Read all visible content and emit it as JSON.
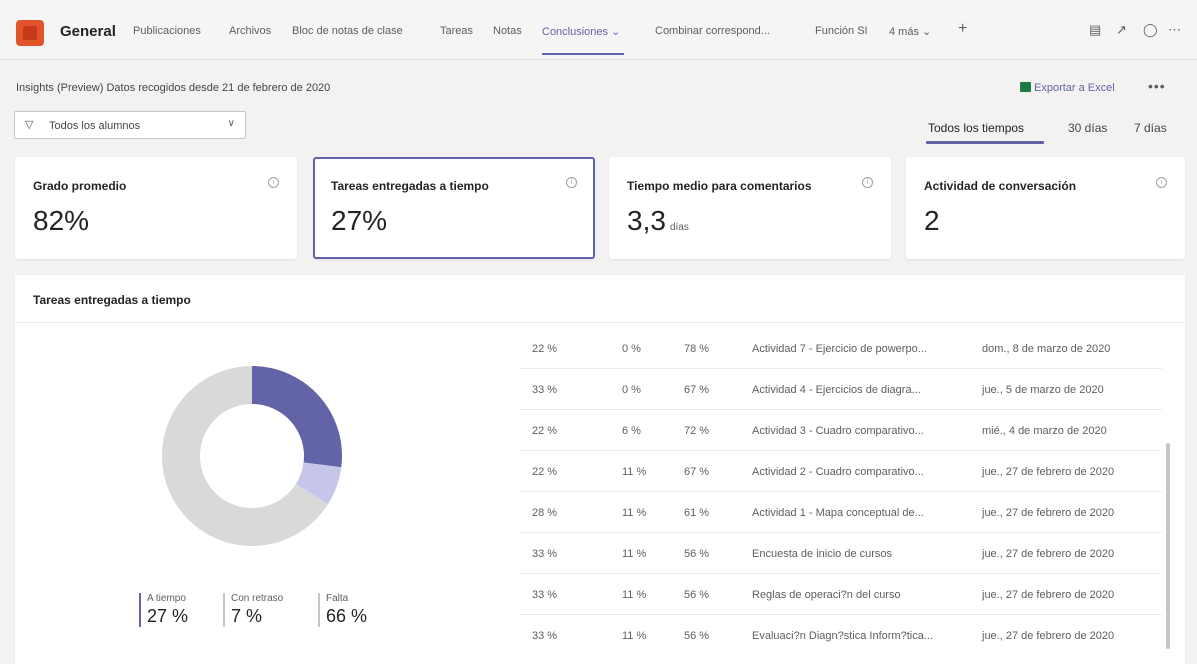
{
  "header": {
    "channel": "General",
    "tabs": [
      "Publicaciones",
      "Archivos",
      "Bloc de notas de clase",
      "Tareas",
      "Notas",
      "Conclusiones ⌄",
      "Combinar correspond...",
      "Función SI",
      "4 más ⌄"
    ],
    "active_tab_index": 5,
    "add_tab": "+"
  },
  "toolbar": {
    "insights_label": "Insights (Preview) Datos recogidos desde 21 de febrero de 2020",
    "export_label": "Exportar a Excel",
    "filter_label": "Todos los alumnos",
    "ranges": [
      "Todos los tiempos",
      "30 días",
      "7 días"
    ],
    "active_range_index": 0
  },
  "cards": [
    {
      "title": "Grado promedio",
      "value": "82%",
      "unit": ""
    },
    {
      "title": "Tareas entregadas a tiempo",
      "value": "27%",
      "unit": "",
      "selected": true
    },
    {
      "title": "Tiempo medio para comentarios",
      "value": "3,3",
      "unit": "días"
    },
    {
      "title": "Actividad de conversación",
      "value": "2",
      "unit": ""
    }
  ],
  "panel": {
    "title": "Tareas entregadas a tiempo",
    "legend": [
      {
        "label": "A tiempo",
        "value": "27 %"
      },
      {
        "label": "Con retraso",
        "value": "7 %"
      },
      {
        "label": "Falta",
        "value": "66 %"
      }
    ],
    "rows": [
      [
        "22 %",
        "0 %",
        "78 %",
        "Actividad 7 - Ejercicio de powerpo...",
        "dom., 8 de marzo de 2020"
      ],
      [
        "33 %",
        "0 %",
        "67 %",
        "Actividad 4 - Ejercicios de diagra...",
        "jue., 5 de marzo de 2020"
      ],
      [
        "22 %",
        "6 %",
        "72 %",
        "Actividad 3 - Cuadro comparativo...",
        "mié., 4 de marzo de 2020"
      ],
      [
        "22 %",
        "11 %",
        "67 %",
        "Actividad 2 - Cuadro comparativo...",
        "jue., 27 de febrero de 2020"
      ],
      [
        "28 %",
        "11 %",
        "61 %",
        "Actividad 1 - Mapa conceptual de...",
        "jue., 27 de febrero de 2020"
      ],
      [
        "33 %",
        "11 %",
        "56 %",
        "Encuesta de inicio de cursos",
        "jue., 27 de febrero de 2020"
      ],
      [
        "33 %",
        "11 %",
        "56 %",
        "Reglas de operaci?n del curso",
        "jue., 27 de febrero de 2020"
      ],
      [
        "33 %",
        "11 %",
        "56 %",
        "Evaluaci?n Diagn?stica Inform?tica...",
        "jue., 27 de febrero de 2020"
      ]
    ]
  },
  "chart_data": {
    "type": "pie",
    "categories": [
      "A tiempo",
      "Con retraso",
      "Falta"
    ],
    "values": [
      27,
      7,
      66
    ],
    "colors": [
      "#6264a7",
      "#c5c6ea",
      "#d9d9d9"
    ]
  }
}
